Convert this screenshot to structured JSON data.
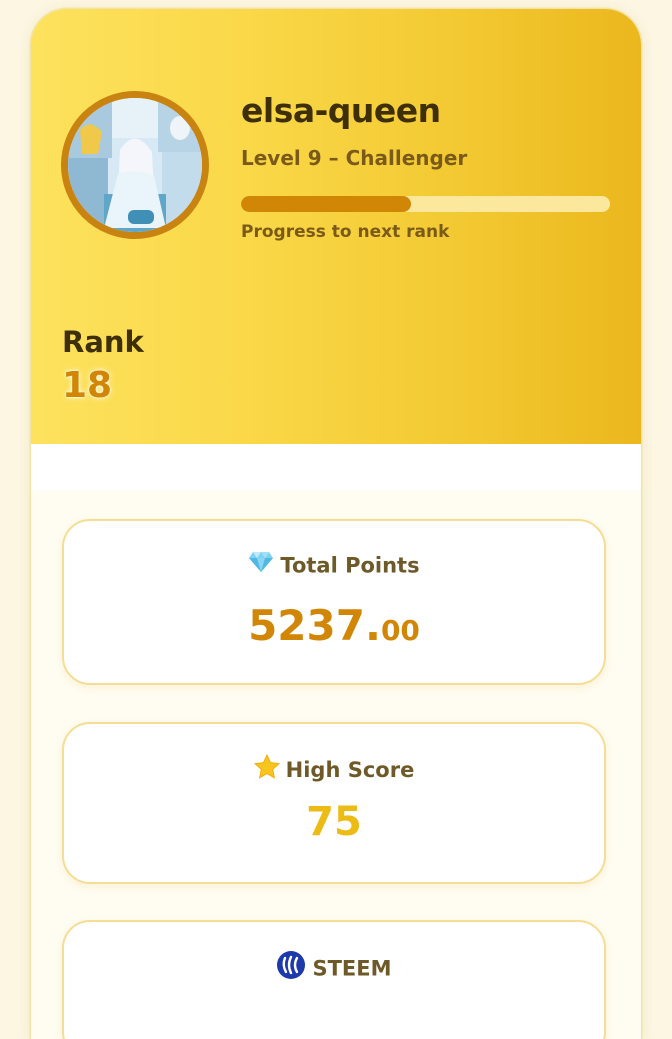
{
  "profile": {
    "username": "elsa-queen",
    "level": "Level 9 – Challenger",
    "progress_label": "Progress to next rank",
    "progress_fraction": 0.46
  },
  "rank": {
    "label": "Rank",
    "value": "18"
  },
  "stats": {
    "total_points": {
      "icon": "gem-icon",
      "label": "Total Points",
      "value_int": "5237.",
      "value_dec": "00"
    },
    "high_score": {
      "icon": "star-icon",
      "label": "High Score",
      "value": "75"
    },
    "steem": {
      "icon": "steem-logo-icon",
      "label": "STEEM"
    }
  },
  "colors": {
    "accent": "#d18606",
    "hero_gradient_start": "#fde25e",
    "hero_gradient_end": "#ebb71d",
    "progress_track": "#fbe89c",
    "score": "#ecbb14"
  }
}
